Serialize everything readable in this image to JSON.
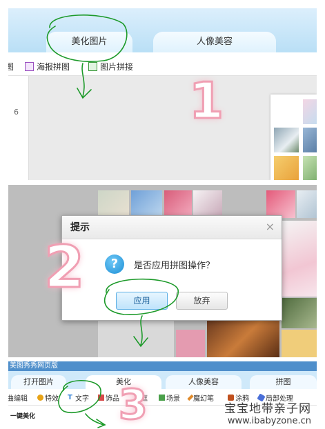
{
  "panel1": {
    "tabs": [
      "美化图片",
      "人像美容"
    ],
    "toolbar": [
      {
        "label": "图",
        "icon": "tool-icon"
      },
      {
        "label": "海报拼图",
        "icon": "poster-collage-icon"
      },
      {
        "label": "图片拼接",
        "icon": "image-stitch-icon"
      }
    ],
    "ruler_number": "6",
    "step": "1"
  },
  "panel2": {
    "dialog": {
      "title": "提示",
      "close": "×",
      "question_icon": "?",
      "message": "是否应用拼图操作？",
      "apply": "应用",
      "discard": "放弃"
    },
    "step": "2"
  },
  "panel3": {
    "title": "美图秀秀网页版",
    "tabs": [
      "打开图片",
      "美化",
      "人像美容",
      "拼图"
    ],
    "toolbar": [
      {
        "label": "曲编辑",
        "icon": "edit-icon",
        "color": "#3a7bd5"
      },
      {
        "label": "特效",
        "icon": "effects-icon",
        "color": "#e8a317"
      },
      {
        "label": "文字",
        "icon": "text-icon",
        "color": "#3a86d8"
      },
      {
        "label": "饰品",
        "icon": "decoration-icon",
        "color": "#d84a4a"
      },
      {
        "label": "框",
        "icon": "frame-icon",
        "color": "#7a7a7a"
      },
      {
        "label": "场景",
        "icon": "scene-icon",
        "color": "#4aa04a"
      },
      {
        "label": "魔幻笔",
        "icon": "magic-pen-icon",
        "color": "#e08a2a"
      },
      {
        "label": "涂鸦",
        "icon": "doodle-icon",
        "color": "#c0501e"
      },
      {
        "label": "局部处理",
        "icon": "local-edit-icon",
        "color": "#4a6fd8"
      }
    ],
    "section": "一键美化",
    "step": "3"
  },
  "watermark": {
    "line1": "宝宝地带亲子网",
    "line2": "www.ibabyzone.cn"
  },
  "colors": {
    "accent_blue": "#4f8fcb",
    "step_pink": "#f09fb3",
    "annotation_green": "#1d9a2a"
  }
}
